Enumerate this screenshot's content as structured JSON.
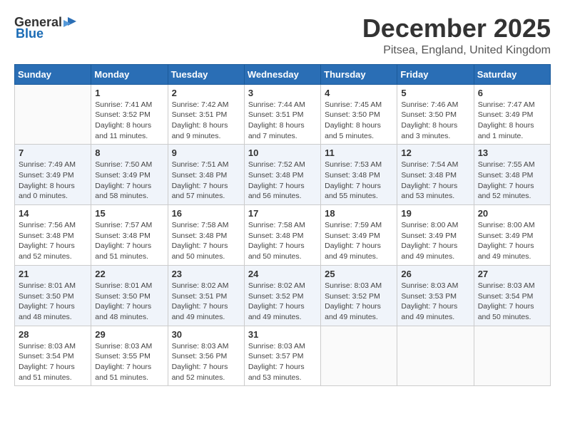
{
  "logo": {
    "general": "General",
    "blue": "Blue"
  },
  "header": {
    "month": "December 2025",
    "location": "Pitsea, England, United Kingdom"
  },
  "days_of_week": [
    "Sunday",
    "Monday",
    "Tuesday",
    "Wednesday",
    "Thursday",
    "Friday",
    "Saturday"
  ],
  "weeks": [
    [
      {
        "day": "",
        "content": ""
      },
      {
        "day": "1",
        "content": "Sunrise: 7:41 AM\nSunset: 3:52 PM\nDaylight: 8 hours\nand 11 minutes."
      },
      {
        "day": "2",
        "content": "Sunrise: 7:42 AM\nSunset: 3:51 PM\nDaylight: 8 hours\nand 9 minutes."
      },
      {
        "day": "3",
        "content": "Sunrise: 7:44 AM\nSunset: 3:51 PM\nDaylight: 8 hours\nand 7 minutes."
      },
      {
        "day": "4",
        "content": "Sunrise: 7:45 AM\nSunset: 3:50 PM\nDaylight: 8 hours\nand 5 minutes."
      },
      {
        "day": "5",
        "content": "Sunrise: 7:46 AM\nSunset: 3:50 PM\nDaylight: 8 hours\nand 3 minutes."
      },
      {
        "day": "6",
        "content": "Sunrise: 7:47 AM\nSunset: 3:49 PM\nDaylight: 8 hours\nand 1 minute."
      }
    ],
    [
      {
        "day": "7",
        "content": "Sunrise: 7:49 AM\nSunset: 3:49 PM\nDaylight: 8 hours\nand 0 minutes."
      },
      {
        "day": "8",
        "content": "Sunrise: 7:50 AM\nSunset: 3:49 PM\nDaylight: 7 hours\nand 58 minutes."
      },
      {
        "day": "9",
        "content": "Sunrise: 7:51 AM\nSunset: 3:48 PM\nDaylight: 7 hours\nand 57 minutes."
      },
      {
        "day": "10",
        "content": "Sunrise: 7:52 AM\nSunset: 3:48 PM\nDaylight: 7 hours\nand 56 minutes."
      },
      {
        "day": "11",
        "content": "Sunrise: 7:53 AM\nSunset: 3:48 PM\nDaylight: 7 hours\nand 55 minutes."
      },
      {
        "day": "12",
        "content": "Sunrise: 7:54 AM\nSunset: 3:48 PM\nDaylight: 7 hours\nand 53 minutes."
      },
      {
        "day": "13",
        "content": "Sunrise: 7:55 AM\nSunset: 3:48 PM\nDaylight: 7 hours\nand 52 minutes."
      }
    ],
    [
      {
        "day": "14",
        "content": "Sunrise: 7:56 AM\nSunset: 3:48 PM\nDaylight: 7 hours\nand 52 minutes."
      },
      {
        "day": "15",
        "content": "Sunrise: 7:57 AM\nSunset: 3:48 PM\nDaylight: 7 hours\nand 51 minutes."
      },
      {
        "day": "16",
        "content": "Sunrise: 7:58 AM\nSunset: 3:48 PM\nDaylight: 7 hours\nand 50 minutes."
      },
      {
        "day": "17",
        "content": "Sunrise: 7:58 AM\nSunset: 3:48 PM\nDaylight: 7 hours\nand 50 minutes."
      },
      {
        "day": "18",
        "content": "Sunrise: 7:59 AM\nSunset: 3:49 PM\nDaylight: 7 hours\nand 49 minutes."
      },
      {
        "day": "19",
        "content": "Sunrise: 8:00 AM\nSunset: 3:49 PM\nDaylight: 7 hours\nand 49 minutes."
      },
      {
        "day": "20",
        "content": "Sunrise: 8:00 AM\nSunset: 3:49 PM\nDaylight: 7 hours\nand 49 minutes."
      }
    ],
    [
      {
        "day": "21",
        "content": "Sunrise: 8:01 AM\nSunset: 3:50 PM\nDaylight: 7 hours\nand 48 minutes."
      },
      {
        "day": "22",
        "content": "Sunrise: 8:01 AM\nSunset: 3:50 PM\nDaylight: 7 hours\nand 48 minutes."
      },
      {
        "day": "23",
        "content": "Sunrise: 8:02 AM\nSunset: 3:51 PM\nDaylight: 7 hours\nand 49 minutes."
      },
      {
        "day": "24",
        "content": "Sunrise: 8:02 AM\nSunset: 3:52 PM\nDaylight: 7 hours\nand 49 minutes."
      },
      {
        "day": "25",
        "content": "Sunrise: 8:03 AM\nSunset: 3:52 PM\nDaylight: 7 hours\nand 49 minutes."
      },
      {
        "day": "26",
        "content": "Sunrise: 8:03 AM\nSunset: 3:53 PM\nDaylight: 7 hours\nand 49 minutes."
      },
      {
        "day": "27",
        "content": "Sunrise: 8:03 AM\nSunset: 3:54 PM\nDaylight: 7 hours\nand 50 minutes."
      }
    ],
    [
      {
        "day": "28",
        "content": "Sunrise: 8:03 AM\nSunset: 3:54 PM\nDaylight: 7 hours\nand 51 minutes."
      },
      {
        "day": "29",
        "content": "Sunrise: 8:03 AM\nSunset: 3:55 PM\nDaylight: 7 hours\nand 51 minutes."
      },
      {
        "day": "30",
        "content": "Sunrise: 8:03 AM\nSunset: 3:56 PM\nDaylight: 7 hours\nand 52 minutes."
      },
      {
        "day": "31",
        "content": "Sunrise: 8:03 AM\nSunset: 3:57 PM\nDaylight: 7 hours\nand 53 minutes."
      },
      {
        "day": "",
        "content": ""
      },
      {
        "day": "",
        "content": ""
      },
      {
        "day": "",
        "content": ""
      }
    ]
  ]
}
